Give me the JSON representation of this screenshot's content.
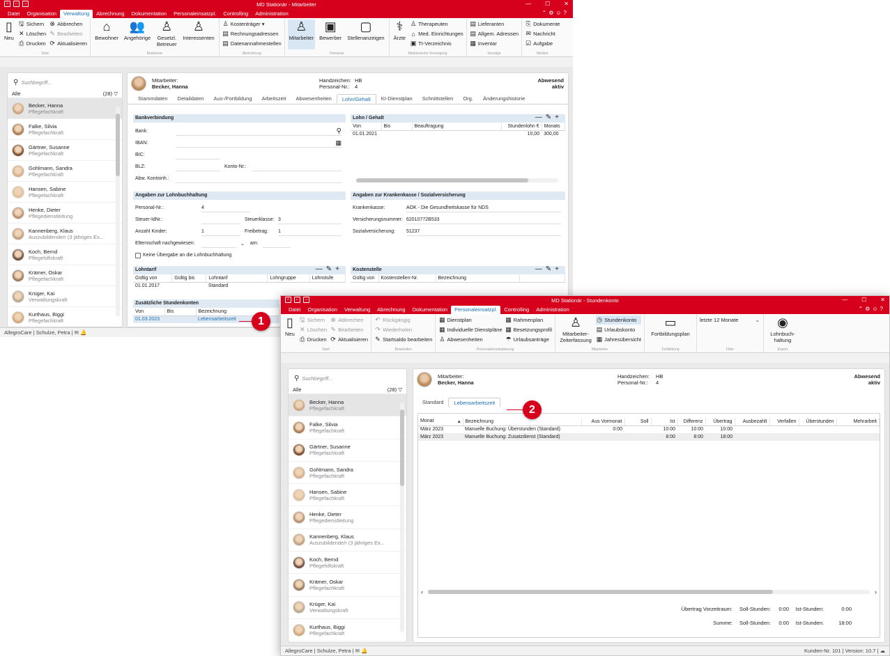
{
  "w1": {
    "title": "MD Stationär - Mitarbeiter",
    "menu": [
      "Datei",
      "Organisation",
      "Verwaltung",
      "Abrechnung",
      "Dokumentation",
      "Personaleinsatzpl.",
      "Controlling",
      "Administration"
    ],
    "ribbon": {
      "start": {
        "label": "Start",
        "neu": "Neu",
        "sichern": "Sichern",
        "abbrechen": "Abbrechen",
        "loeschen": "Löschen",
        "bearbeiten": "Bearbeiten",
        "drucken": "Drucken",
        "aktualisieren": "Aktualisieren"
      },
      "bewohner": {
        "label": "Bewohner",
        "items": [
          "Bewohner",
          "Angehörige",
          "Gesetzl. Betreuer",
          "Interessenten"
        ]
      },
      "abrechnung": {
        "label": "Abrechnung",
        "items": [
          "Kostenträger ▾",
          "Rechnungsadressen",
          "Datenannahmestellen"
        ]
      },
      "personal": {
        "label": "Personal",
        "items": [
          "Mitarbeiter",
          "Bewerber",
          "Stellenanzeigen"
        ]
      },
      "med": {
        "label": "Medizinische Versorgung",
        "aerzte": "Ärzte",
        "items": [
          "Therapeuten",
          "Med. Einrichtungen",
          "TI-Verzeichnis"
        ]
      },
      "sonstige": {
        "label": "Sonstige",
        "items": [
          "Lieferanten",
          "Allgem. Adressen",
          "Inventar"
        ]
      },
      "medien": {
        "label": "Medien",
        "items": [
          "Dokumente",
          "Nachricht",
          "Aufgabe"
        ]
      }
    },
    "search_placeholder": "Suchbegriff...",
    "filter_all": "Alle",
    "filter_count": "(28)",
    "header": {
      "label": "Mitarbeiter:",
      "name": "Becker, Hanna",
      "hz_label": "Handzeichen:",
      "hz": "HB",
      "pnr_label": "Personal-Nr.:",
      "pnr": "4",
      "status1": "Abwesend",
      "status2": "aktiv"
    },
    "tabs": [
      "Stammdaten",
      "Detaildaten",
      "Aus-/Fortbildung",
      "Arbeitszeit",
      "Abwesenheiten",
      "Lohn/Gehalt",
      "KI-Dienstplan",
      "Schnittstellen",
      "Org.",
      "Änderungshistorie"
    ],
    "bank": {
      "title": "Bankverbindung",
      "bank": "Bank:",
      "iban": "IBAN:",
      "bic": "BIC:",
      "blz": "BLZ:",
      "konto": "Konto-Nr.:",
      "abw": "Abw. Kontoinh.:"
    },
    "lohn": {
      "title": "Lohn / Gehalt",
      "cols": [
        "Von",
        "Bis",
        "Beauftragung",
        "Stundenlohn €",
        "Monats"
      ],
      "row": [
        "01.01.2021",
        "",
        "",
        "10,00",
        "300,00"
      ]
    },
    "lohnbuch": {
      "title": "Angaben zur Lohnbuchhaltung",
      "pnr": "Personal-Nr.:",
      "pnr_v": "4",
      "steuerid": "Steuer-IdNr.:",
      "stkl": "Steuerklasse:",
      "stkl_v": "3",
      "kinder": "Anzahl Kinder:",
      "kinder_v": "1",
      "freib": "Freibetrag:",
      "freib_v": "1",
      "eltern": "Elternschaft nachgewiesen:",
      "am": "am:",
      "keine": "Keine Übergabe an die Lohnbuchhaltung"
    },
    "kk": {
      "title": "Angaben zur Krankenkasse / Sozialversicherung",
      "kk": "Krankenkasse:",
      "kk_v": "AOK - Die Gesundheitskasse für NDS",
      "vnr": "Versicherungsnummer:",
      "vnr_v": "62010772B533",
      "sv": "Sozialversicherung:",
      "sv_v": "51237"
    },
    "tarif": {
      "title": "Lohntarif",
      "cols": [
        "Gültig von",
        "Gültig bis",
        "Lohntarif",
        "Lohngruppe",
        "Lohnstufe"
      ],
      "row": [
        "01.01.2017",
        "",
        "Standard",
        "",
        ""
      ]
    },
    "kst": {
      "title": "Kostenstelle",
      "cols": [
        "Gültig von",
        "Kostenstellen-Nr.",
        "Bezeichnung"
      ]
    },
    "zus": {
      "title": "Zusätzliche Stundenkonten",
      "cols": [
        "Von",
        "Bis",
        "Bezeichnung"
      ],
      "row": [
        "01.03.2023",
        "",
        "Lebensarbeitszeit"
      ]
    },
    "status": "AllegroCare | Schulze, Petra"
  },
  "employees": [
    {
      "name": "Becker, Hanna",
      "role": "Pflegefachkraft"
    },
    {
      "name": "Falke, Silvia",
      "role": "Pflegefachkraft"
    },
    {
      "name": "Gärtner, Susanne",
      "role": "Pflegefachkraft"
    },
    {
      "name": "Gohlmann, Sandra",
      "role": "Pflegefachkraft"
    },
    {
      "name": "Hansen, Sabine",
      "role": "Pflegefachkraft"
    },
    {
      "name": "Henke, Dieter",
      "role": "Pflegedienstleitung"
    },
    {
      "name": "Kannenberg, Klaus",
      "role": "Auszubildende/r (3 jähriges Ex..."
    },
    {
      "name": "Koch, Bernd",
      "role": "Pflegehilfskraft"
    },
    {
      "name": "Krämer, Oskar",
      "role": "Pflegefachkraft"
    },
    {
      "name": "Krüger, Kai",
      "role": "Verwaltungskraft"
    },
    {
      "name": "Kurthaus, Biggi",
      "role": "Pflegefachkraft"
    }
  ],
  "w2": {
    "title": "MD Stationär - Stundenkonto",
    "menu": [
      "Datei",
      "Organisation",
      "Verwaltung",
      "Abrechnung",
      "Dokumentation",
      "Personaleinsatzpl.",
      "Controlling",
      "Administration"
    ],
    "ribbon": {
      "start": {
        "label": "Start",
        "neu": "Neu",
        "sichern": "Sichern",
        "abbrechen": "Abbrechen",
        "loeschen": "Löschen",
        "bearbeiten": "Bearbeiten",
        "drucken": "Drucken",
        "aktualisieren": "Aktualisieren"
      },
      "bearbeiten": {
        "label": "Bearbeiten",
        "items": [
          "Rückgängig",
          "Wiederholen",
          "Startsaldo bearbeiten"
        ]
      },
      "pep": {
        "label": "Personaleinsatzplanung",
        "items": [
          "Dienstplan",
          "Individuelle Dienstpläne",
          "Abwesenheiten",
          "Rahmenplan",
          "Besetzungsprofil",
          "Urlaubsanträge"
        ]
      },
      "ma": {
        "label": "Mitarbeiter",
        "big": "Mitarbeiter-Zeiterfassung",
        "items": [
          "Stundenkonto",
          "Urlaubskonto",
          "Jahresübersicht"
        ]
      },
      "fb": {
        "label": "Fortbildung",
        "big": "Fortbildungsplan"
      },
      "filter": {
        "label": "Filter",
        "value": "letzte 12 Monate"
      },
      "export": {
        "label": "Export",
        "big": "Lohnbuch-haltung"
      }
    },
    "search_placeholder": "Suchbegriff...",
    "filter_all": "Alle",
    "filter_count": "(28)",
    "header": {
      "label": "Mitarbeiter:",
      "name": "Becker, Hanna",
      "hz_label": "Handzeichen:",
      "hz": "HB",
      "pnr_label": "Personal-Nr.:",
      "pnr": "4",
      "status1": "Abwesend",
      "status2": "aktiv"
    },
    "tabs": [
      "Standard",
      "Lebensarbeitszeit"
    ],
    "cols": [
      "Monat",
      "Bezeichnung",
      "Aus Vormonat",
      "Soll",
      "Ist",
      "Differenz",
      "Übertrag",
      "Ausbezahlt",
      "Verfallen",
      "Überstunden",
      "Mehrarbeit"
    ],
    "rows": [
      [
        "März 2023",
        "Manuelle Buchung: Überstunden (Standard)",
        "0:00",
        "",
        "10:00",
        "10:00",
        "10:00",
        "",
        "",
        "",
        ""
      ],
      [
        "März 2023",
        "Manuelle Buchung: Zusatzdienst (Standard)",
        "",
        "",
        "8:00",
        "8:00",
        "18:00",
        "",
        "",
        "",
        ""
      ]
    ],
    "foot": {
      "uebertrag": "Übertrag Vorzeitraum:",
      "summe": "Summe:",
      "soll": "Soll-Stunden:",
      "ist": "Ist-Stunden:",
      "u_soll": "0:00",
      "u_ist": "0:00",
      "s_soll": "0:00",
      "s_ist": "18:00"
    },
    "status": "AllegroCare | Schulze, Petra",
    "status_right": "Kunden-Nr. 101 | Version: 10.7 |"
  },
  "badges": [
    "1",
    "2"
  ],
  "colors": {
    "brand": "#d6001c",
    "accent": "#1a6fb4",
    "header": "#dfe9f4"
  }
}
